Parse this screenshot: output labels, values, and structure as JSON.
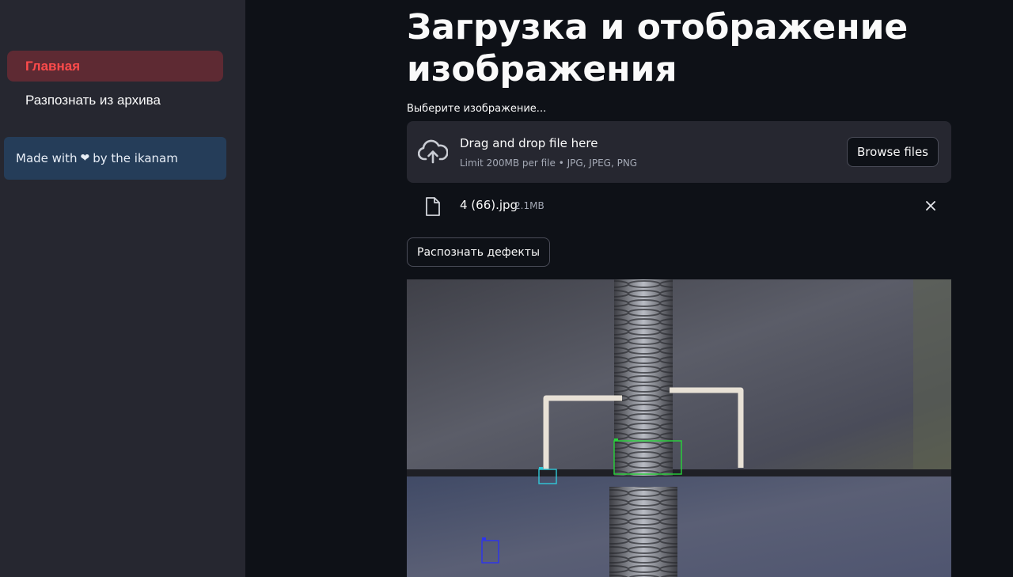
{
  "sidebar": {
    "nav": [
      {
        "label": "Главная",
        "active": true
      },
      {
        "label": "Разпознать из архива",
        "active": false
      }
    ],
    "info": {
      "prefix": "Made with",
      "heart": "❤",
      "suffix": "by the ikanam"
    }
  },
  "main": {
    "title": "Загрузка и отображение изображения",
    "uploader": {
      "label": "Выберите изображение...",
      "drop_title": "Drag and drop file here",
      "drop_limit": "Limit 200MB per file • JPG, JPEG, PNG",
      "browse_label": "Browse files",
      "file": {
        "name": "4 (66).jpg",
        "size": "2.1MB"
      }
    },
    "recognize_label": "Распознать дефекты"
  },
  "colors": {
    "app_bg": "#0e1117",
    "sidebar_bg": "#262730",
    "accent": "#ff4b4b",
    "info_bg": "#253d59"
  }
}
